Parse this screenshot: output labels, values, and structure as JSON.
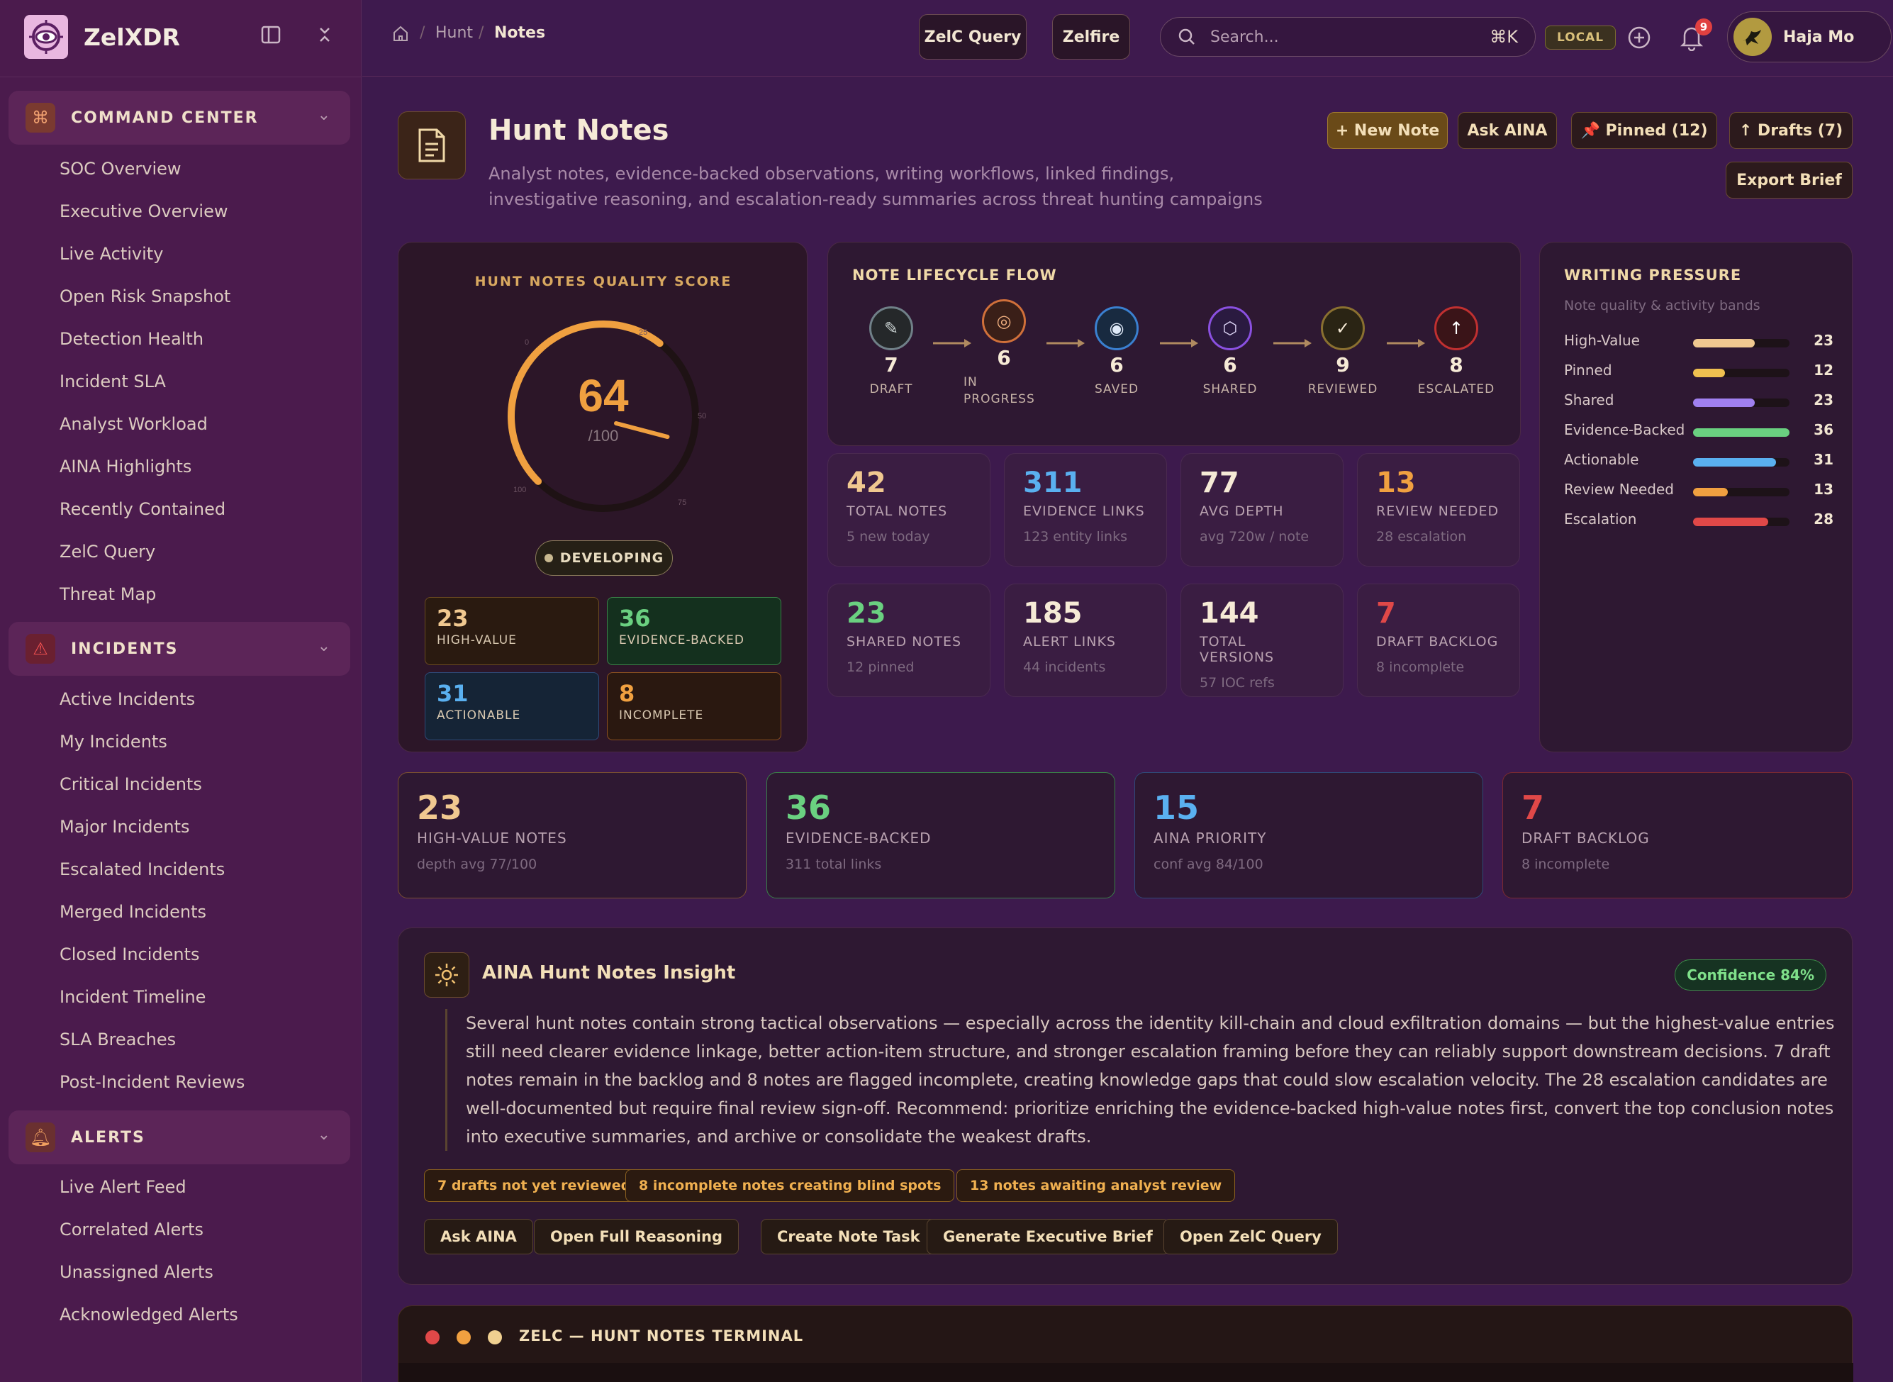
{
  "brand": {
    "name": "ZelXDR"
  },
  "sidebar": {
    "sections": [
      {
        "title": "COMMAND CENTER",
        "items": [
          "SOC Overview",
          "Executive Overview",
          "Live Activity",
          "Open Risk Snapshot",
          "Detection Health",
          "Incident SLA",
          "Analyst Workload",
          "AINA Highlights",
          "Recently Contained",
          "ZelC Query",
          "Threat Map"
        ]
      },
      {
        "title": "INCIDENTS",
        "items": [
          "Active Incidents",
          "My Incidents",
          "Critical Incidents",
          "Major Incidents",
          "Escalated Incidents",
          "Merged Incidents",
          "Closed Incidents",
          "Incident Timeline",
          "SLA Breaches",
          "Post-Incident Reviews"
        ]
      },
      {
        "title": "ALERTS",
        "items": [
          "Live Alert Feed",
          "Correlated Alerts",
          "Unassigned Alerts",
          "Acknowledged Alerts"
        ]
      }
    ]
  },
  "topbar": {
    "breadcrumb": [
      "Hunt",
      "Notes"
    ],
    "zelc_query": "ZelC Query",
    "zelfire": "Zelfire",
    "search_placeholder": "Search...",
    "shortcut": "⌘K",
    "env": "LOCAL",
    "notifications": "9",
    "user": "Haja Mo"
  },
  "header": {
    "title": "Hunt Notes",
    "subtitle": "Analyst notes, evidence-backed observations, writing workflows, linked findings, investigative reasoning, and escalation-ready summaries across threat hunting campaigns",
    "new_note": "+ New Note",
    "ask_aina": "Ask AINA",
    "pinned": "📌 Pinned (12)",
    "drafts": "↑ Drafts (7)",
    "export": "Export Brief"
  },
  "quality": {
    "title": "HUNT NOTES QUALITY SCORE",
    "score": "64",
    "max": "/100",
    "score_value": 64,
    "ticks": [
      "0",
      "25",
      "50",
      "75",
      "100"
    ],
    "status": "DEVELOPING",
    "metrics": [
      {
        "value": "23",
        "label": "HIGH-VALUE"
      },
      {
        "value": "36",
        "label": "EVIDENCE-BACKED"
      },
      {
        "value": "31",
        "label": "ACTIONABLE"
      },
      {
        "value": "8",
        "label": "INCOMPLETE"
      }
    ]
  },
  "lifecycle": {
    "title": "NOTE LIFECYCLE FLOW",
    "steps": [
      {
        "count": "7",
        "label": "DRAFT",
        "icon": "✎"
      },
      {
        "count": "6",
        "label": "IN PROGRESS",
        "icon": "◎"
      },
      {
        "count": "6",
        "label": "SAVED",
        "icon": "◉"
      },
      {
        "count": "6",
        "label": "SHARED",
        "icon": "⬡"
      },
      {
        "count": "9",
        "label": "REVIEWED",
        "icon": "✓"
      },
      {
        "count": "8",
        "label": "ESCALATED",
        "icon": "↑"
      }
    ]
  },
  "stats": [
    {
      "value": "42",
      "label": "TOTAL NOTES",
      "sub": "5 new today",
      "color": "#f0c890"
    },
    {
      "value": "311",
      "label": "EVIDENCE LINKS",
      "sub": "123 entity links",
      "color": "#5ab0f0"
    },
    {
      "value": "77",
      "label": "AVG DEPTH",
      "sub": "avg 720w / note",
      "color": "#f6ead6"
    },
    {
      "value": "13",
      "label": "REVIEW NEEDED",
      "sub": "28 escalation",
      "color": "#f0a040"
    },
    {
      "value": "23",
      "label": "SHARED NOTES",
      "sub": "12 pinned",
      "color": "#6ad080"
    },
    {
      "value": "185",
      "label": "ALERT LINKS",
      "sub": "44 incidents",
      "color": "#f6ead6"
    },
    {
      "value": "144",
      "label": "TOTAL VERSIONS",
      "sub": "57 IOC refs",
      "color": "#f6ead6"
    },
    {
      "value": "7",
      "label": "DRAFT BACKLOG",
      "sub": "8 incomplete",
      "color": "#e04848"
    }
  ],
  "pressure": {
    "title": "WRITING PRESSURE",
    "subtitle": "Note quality & activity bands",
    "rows": [
      {
        "label": "High-Value",
        "value": "23",
        "fill": 0.64,
        "color": "#f0c890"
      },
      {
        "label": "Pinned",
        "value": "12",
        "fill": 0.33,
        "color": "#f0c050"
      },
      {
        "label": "Shared",
        "value": "23",
        "fill": 0.64,
        "color": "#a080f0"
      },
      {
        "label": "Evidence-Backed",
        "value": "36",
        "fill": 1.0,
        "color": "#6ad080"
      },
      {
        "label": "Actionable",
        "value": "31",
        "fill": 0.86,
        "color": "#5ab0f0"
      },
      {
        "label": "Review Needed",
        "value": "13",
        "fill": 0.36,
        "color": "#f0a040"
      },
      {
        "label": "Escalation",
        "value": "28",
        "fill": 0.78,
        "color": "#e04848"
      }
    ]
  },
  "highlights": [
    {
      "value": "23",
      "label": "HIGH-VALUE NOTES",
      "sub": "depth avg 77/100",
      "color": "#f0c890",
      "border": "#7a5030"
    },
    {
      "value": "36",
      "label": "EVIDENCE-BACKED",
      "sub": "311 total links",
      "color": "#6ad080",
      "border": "#3a8048"
    },
    {
      "value": "15",
      "label": "AINA PRIORITY",
      "sub": "conf avg 84/100",
      "color": "#5ab0f0",
      "border": "#2f4a78"
    },
    {
      "value": "7",
      "label": "DRAFT BACKLOG",
      "sub": "8 incomplete",
      "color": "#e04848",
      "border": "#7a2a30"
    }
  ],
  "insight": {
    "title": "AINA Hunt Notes Insight",
    "confidence": "Confidence 84%",
    "text": "Several hunt notes contain strong tactical observations — especially across the identity kill-chain and cloud exfiltration domains — but the highest-value entries still need clearer evidence linkage, better action-item structure, and stronger escalation framing before they can reliably support downstream decisions. 7 draft notes remain in the backlog and 8 notes are flagged incomplete, creating knowledge gaps that could slow escalation velocity. The 28 escalation candidates are well-documented but require final review sign-off. Recommend: prioritize enriching the evidence-backed high-value notes first, convert the top conclusion notes into executive summaries, and archive or consolidate the weakest drafts.",
    "tags": [
      "7 drafts not yet reviewed",
      "8 incomplete notes creating blind spots",
      "13 notes awaiting analyst review"
    ],
    "actions": [
      "Ask AINA",
      "Open Full Reasoning",
      "Create Note Task",
      "Generate Executive Brief",
      "Open ZelC Query"
    ]
  },
  "terminal": {
    "title": "ZELC — HUNT NOTES TERMINAL"
  }
}
